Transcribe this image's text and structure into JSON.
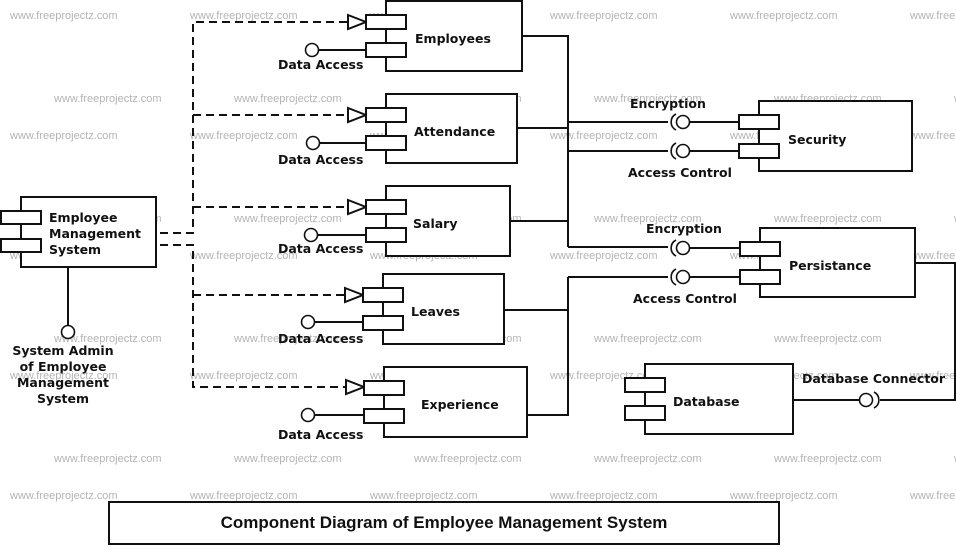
{
  "diagram": {
    "title": "Component Diagram of Employee Management System",
    "watermark": "www.freeprojectz.com",
    "main_component": {
      "label_lines": [
        "Employee",
        "Management",
        "System"
      ]
    },
    "admin_interface": {
      "label_lines": [
        "System Admin",
        "of Employee",
        "Management",
        "System"
      ]
    },
    "modules": [
      {
        "name": "Employees",
        "interface": "Data Access"
      },
      {
        "name": "Attendance",
        "interface": "Data Access"
      },
      {
        "name": "Salary",
        "interface": "Data Access"
      },
      {
        "name": "Leaves",
        "interface": "Data Access"
      },
      {
        "name": "Experience",
        "interface": "Data Access"
      }
    ],
    "services": [
      {
        "name": "Security",
        "interfaces": [
          "Encryption",
          "Access Control"
        ]
      },
      {
        "name": "Persistance",
        "interfaces": [
          "Encryption",
          "Access Control"
        ]
      }
    ],
    "database": {
      "name": "Database",
      "interface": "Database Connector"
    }
  }
}
